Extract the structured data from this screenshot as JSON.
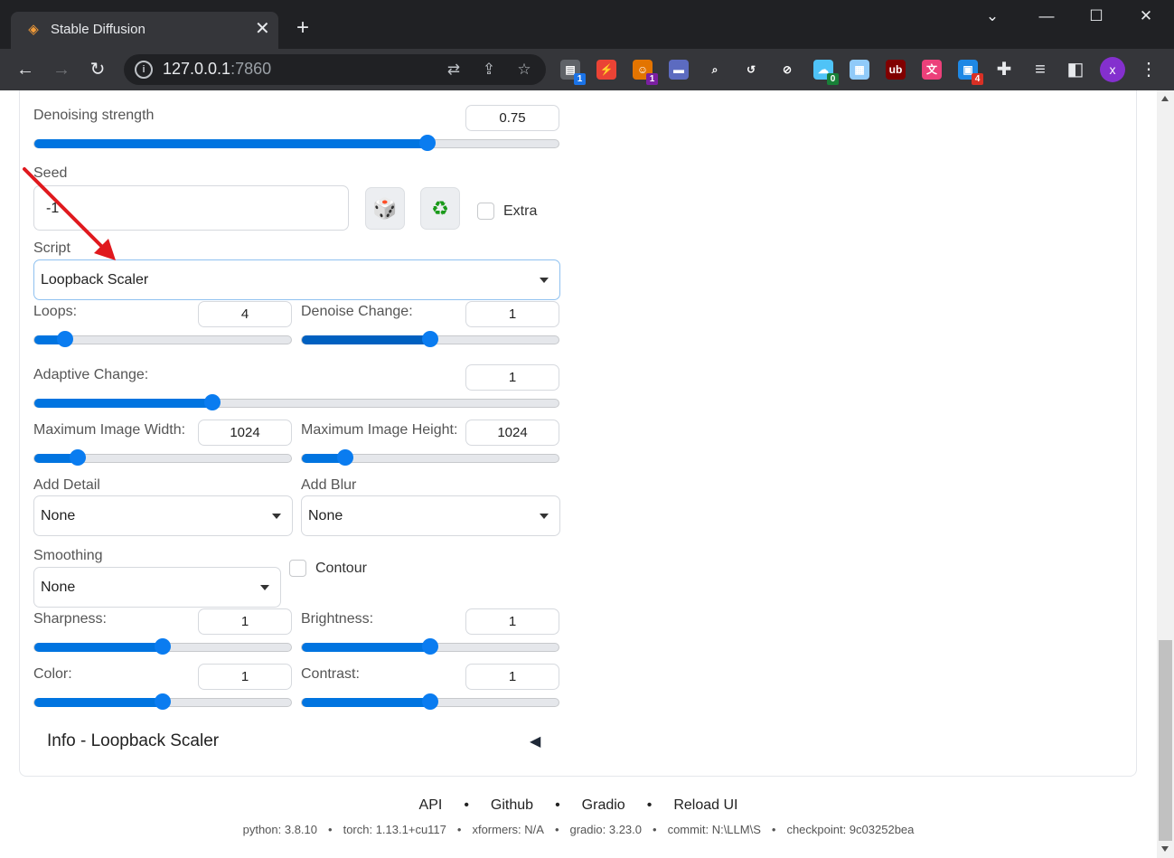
{
  "browser": {
    "tab_title": "Stable Diffusion",
    "tab_close": "✕",
    "new_tab": "+",
    "url_host": "127.0.0.1",
    "url_port": ":7860",
    "avatar_initial": "x",
    "extensions": [
      {
        "name": "extension-1-icon",
        "badge": "1",
        "badge_color": "#1a73e8",
        "color": "#5f6368"
      },
      {
        "name": "extension-bolt-icon",
        "badge": "",
        "color": "#ea4335"
      },
      {
        "name": "extension-monkey-icon",
        "badge": "1",
        "badge_color": "#7b1fa2",
        "color": "#e37400"
      },
      {
        "name": "extension-window-icon",
        "badge": "",
        "color": "#5c6bc0"
      },
      {
        "name": "extension-search-icon",
        "badge": "",
        "color": "#35363a"
      },
      {
        "name": "extension-refresh-icon",
        "badge": "",
        "color": "#35363a"
      },
      {
        "name": "extension-block-icon",
        "badge": "",
        "color": "#35363a"
      },
      {
        "name": "extension-cloud-icon",
        "badge": "0",
        "badge_color": "#188038",
        "color": "#4fc3f7"
      },
      {
        "name": "extension-shorts-icon",
        "badge": "",
        "color": "#90caf9"
      },
      {
        "name": "extension-ublock-icon",
        "badge": "",
        "color": "#800000"
      },
      {
        "name": "extension-translate-icon",
        "badge": "",
        "color": "#ec407a"
      },
      {
        "name": "extension-apps-icon",
        "badge": "4",
        "badge_color": "#d93025",
        "color": "#1e88e5"
      }
    ]
  },
  "form": {
    "denoising_label": "Denoising strength",
    "denoising_value": "0.75",
    "denoising_fraction": 0.75,
    "seed_label": "Seed",
    "seed_value": "-1",
    "extra_label": "Extra",
    "script_label": "Script",
    "script_value": "Loopback Scaler",
    "loops_label": "Loops:",
    "loops_value": "4",
    "loops_fraction": 0.12,
    "denoise_change_label": "Denoise Change:",
    "denoise_change_value": "1",
    "denoise_change_fraction": 0.5,
    "adaptive_change_label": "Adaptive Change:",
    "adaptive_change_value": "1",
    "adaptive_change_fraction": 0.34,
    "max_width_label": "Maximum Image Width:",
    "max_width_value": "1024",
    "max_width_fraction": 0.17,
    "max_height_label": "Maximum Image Height:",
    "max_height_value": "1024",
    "max_height_fraction": 0.17,
    "add_detail_label": "Add Detail",
    "add_detail_value": "None",
    "add_blur_label": "Add Blur",
    "add_blur_value": "None",
    "smoothing_label": "Smoothing",
    "smoothing_value": "None",
    "contour_label": "Contour",
    "sharpness_label": "Sharpness:",
    "sharpness_value": "1",
    "sharpness_fraction": 0.5,
    "brightness_label": "Brightness:",
    "brightness_value": "1",
    "brightness_fraction": 0.5,
    "color_label": "Color:",
    "color_value": "1",
    "color_fraction": 0.5,
    "contrast_label": "Contrast:",
    "contrast_value": "1",
    "contrast_fraction": 0.5,
    "info_label": "Info - Loopback Scaler",
    "info_toggle": "◀"
  },
  "footer": {
    "links": [
      "API",
      "Github",
      "Gradio",
      "Reload UI"
    ],
    "separator": "•",
    "python": "python: 3.8.10",
    "torch": "torch: 1.13.1+cu117",
    "xformers": "xformers: N/A",
    "gradio": "gradio: 3.23.0",
    "commit": "commit: N:\\LLM\\S",
    "checkpoint": "checkpoint: 9c03252bea"
  },
  "colors": {
    "accent": "#0a7cf0",
    "arrow": "#e0191e"
  }
}
